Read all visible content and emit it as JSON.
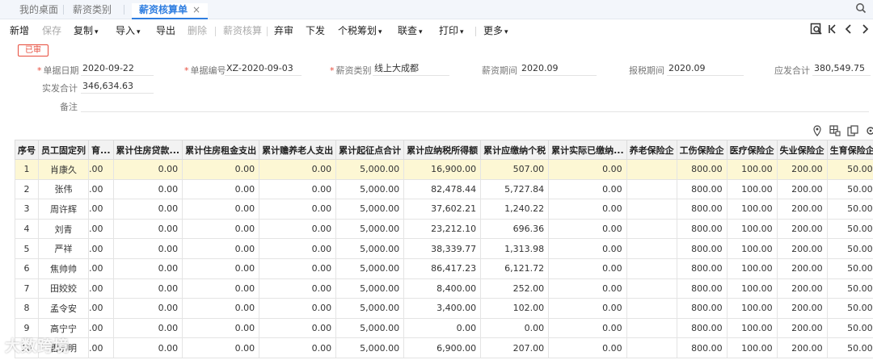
{
  "tabs": [
    {
      "label": "我的桌面"
    },
    {
      "label": "薪资类别"
    },
    {
      "label": "薪资核算单",
      "close": "×"
    }
  ],
  "toolbar": {
    "new": "新增",
    "save": "保存",
    "copy": "复制",
    "import": "导入",
    "export": "导出",
    "delete": "删除",
    "calc": "薪资核算",
    "abandon": "弃审",
    "issue": "下发",
    "tax_plan": "个税筹划",
    "link_query": "联查",
    "print": "打印",
    "more": "更多",
    "caret": "▾"
  },
  "form": {
    "status": "已审",
    "doc_date_label": "单据日期",
    "doc_date": "2020-09-22",
    "doc_no_label": "单据编号",
    "doc_no": "XZ-2020-09-03",
    "category_label": "薪资类别",
    "category": "线上大成都",
    "period_label": "薪资期间",
    "period": "2020.09",
    "tax_period_label": "报税期间",
    "tax_period": "2020.09",
    "payable_label": "应发合计",
    "payable": "380,549.75",
    "actual_label": "实发合计",
    "actual": "346,634.63",
    "remark_label": "备注",
    "remark": "",
    "required_mark": "*"
  },
  "table": {
    "columns": [
      "序号",
      "员工固定列",
      "育...",
      "累计住房贷款...",
      "累计住房租金支出",
      "累计赡养老人支出",
      "累计起征点合计",
      "累计应纳税所得额",
      "累计应缴纳个税",
      "累计实际已缴纳...",
      "养老保险企",
      "工伤保险企",
      "医疗保险企",
      "失业保险企",
      "生育保险企",
      "住"
    ],
    "rows": [
      [
        "1",
        "肖康久",
        ".00",
        "0.00",
        "0.00",
        "0.00",
        "5,000.00",
        "16,900.00",
        "507.00",
        "0.00",
        "",
        "800.00",
        "100.00",
        "200.00",
        "50.00"
      ],
      [
        "2",
        "张伟",
        ".00",
        "0.00",
        "0.00",
        "0.00",
        "5,000.00",
        "82,478.44",
        "5,727.84",
        "0.00",
        "",
        "800.00",
        "100.00",
        "200.00",
        "50.00"
      ],
      [
        "3",
        "周许辉",
        ".00",
        "0.00",
        "0.00",
        "0.00",
        "5,000.00",
        "37,602.21",
        "1,240.22",
        "0.00",
        "",
        "800.00",
        "100.00",
        "200.00",
        "50.00"
      ],
      [
        "4",
        "刘青",
        ".00",
        "0.00",
        "0.00",
        "0.00",
        "5,000.00",
        "23,212.10",
        "696.36",
        "0.00",
        "",
        "800.00",
        "100.00",
        "200.00",
        "50.00"
      ],
      [
        "5",
        "严祥",
        ".00",
        "0.00",
        "0.00",
        "0.00",
        "5,000.00",
        "38,339.77",
        "1,313.98",
        "0.00",
        "",
        "800.00",
        "100.00",
        "200.00",
        "50.00"
      ],
      [
        "6",
        "焦帅帅",
        ".00",
        "0.00",
        "0.00",
        "0.00",
        "5,000.00",
        "86,417.23",
        "6,121.72",
        "0.00",
        "",
        "800.00",
        "100.00",
        "200.00",
        "50.00"
      ],
      [
        "7",
        "田姣姣",
        ".00",
        "0.00",
        "0.00",
        "0.00",
        "5,000.00",
        "8,400.00",
        "252.00",
        "0.00",
        "",
        "800.00",
        "100.00",
        "200.00",
        "50.00"
      ],
      [
        "8",
        "孟令安",
        ".00",
        "0.00",
        "0.00",
        "0.00",
        "5,000.00",
        "3,400.00",
        "102.00",
        "0.00",
        "",
        "800.00",
        "100.00",
        "200.00",
        "50.00"
      ],
      [
        "9",
        "高宁宁",
        ".00",
        "0.00",
        "0.00",
        "0.00",
        "5,000.00",
        "0.00",
        "0.00",
        "0.00",
        "",
        "800.00",
        "100.00",
        "200.00",
        "50.00"
      ],
      [
        "10",
        "雷明明",
        ".00",
        "0.00",
        "0.00",
        "0.00",
        "5,000.00",
        "6,900.00",
        "207.00",
        "0.00",
        "",
        "800.00",
        "100.00",
        "200.00",
        "50.00"
      ]
    ]
  },
  "watermark": "大数跨境",
  "colors": {
    "accent": "#2f7ee0",
    "selected_row": "#fdf7d4",
    "status": "#e74c3c"
  }
}
